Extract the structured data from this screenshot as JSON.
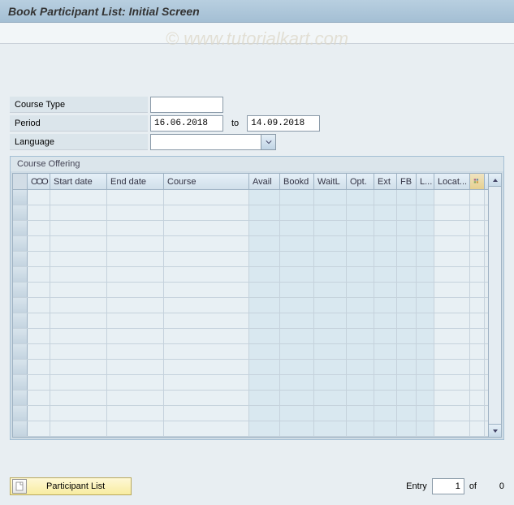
{
  "titlebar": {
    "title": "Book Participant List: Initial Screen"
  },
  "watermark": "© www.tutorialkart.com",
  "form": {
    "course_type_label": "Course Type",
    "course_type_value": "",
    "period_label": "Period",
    "period_from": "16.06.2018",
    "period_to_label": "to",
    "period_to": "14.09.2018",
    "language_label": "Language",
    "language_value": ""
  },
  "table": {
    "groupbox_title": "Course Offering",
    "columns": {
      "status": "OOO",
      "start_date": "Start date",
      "end_date": "End date",
      "course": "Course",
      "avail": "Avail",
      "bookd": "Bookd",
      "waitl": "WaitL",
      "opt": "Opt.",
      "ext": "Ext",
      "fb": "FB",
      "l": "L...",
      "locat": "Locat..."
    },
    "rows": []
  },
  "footer": {
    "participant_list_label": "Participant List",
    "entry_label": "Entry",
    "entry_value": "1",
    "of_label": "of",
    "entry_total": "0"
  }
}
